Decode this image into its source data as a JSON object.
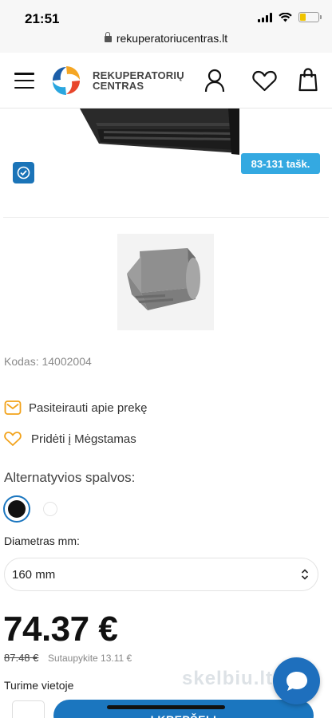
{
  "status": {
    "time": "21:51",
    "battery_level": 0.3
  },
  "browser": {
    "url": "rekuperatoriucentras.lt"
  },
  "header": {
    "logo_line1": "REKUPERATORIŲ",
    "logo_line2": "CENTRAS",
    "icons": [
      "menu-icon",
      "user-icon",
      "heart-icon",
      "bag-icon"
    ]
  },
  "product": {
    "points_badge": "83-131 tašk.",
    "code": "Kodas: 14002004",
    "ask_label": "Pasiteirauti apie prekę",
    "favorite_label": "Pridėti į Mėgstamas",
    "alt_colors_title": "Alternatyvios spalvos:",
    "colors": [
      "#111111",
      "#ffffff"
    ],
    "diameter_label": "Diametras mm:",
    "diameter_value": "160 mm",
    "price": "74.37 €",
    "old_price": "87.48 €",
    "savings": "Sutaupykite 13.11 €",
    "stock": "Turime vietoje",
    "cart_button": "Į KREPŠELĮ"
  },
  "colors": {
    "accent": "#1b76bf",
    "badge": "#34a9e1",
    "icon_orange": "#f2a21a"
  },
  "watermark": "skelbiu.lt"
}
